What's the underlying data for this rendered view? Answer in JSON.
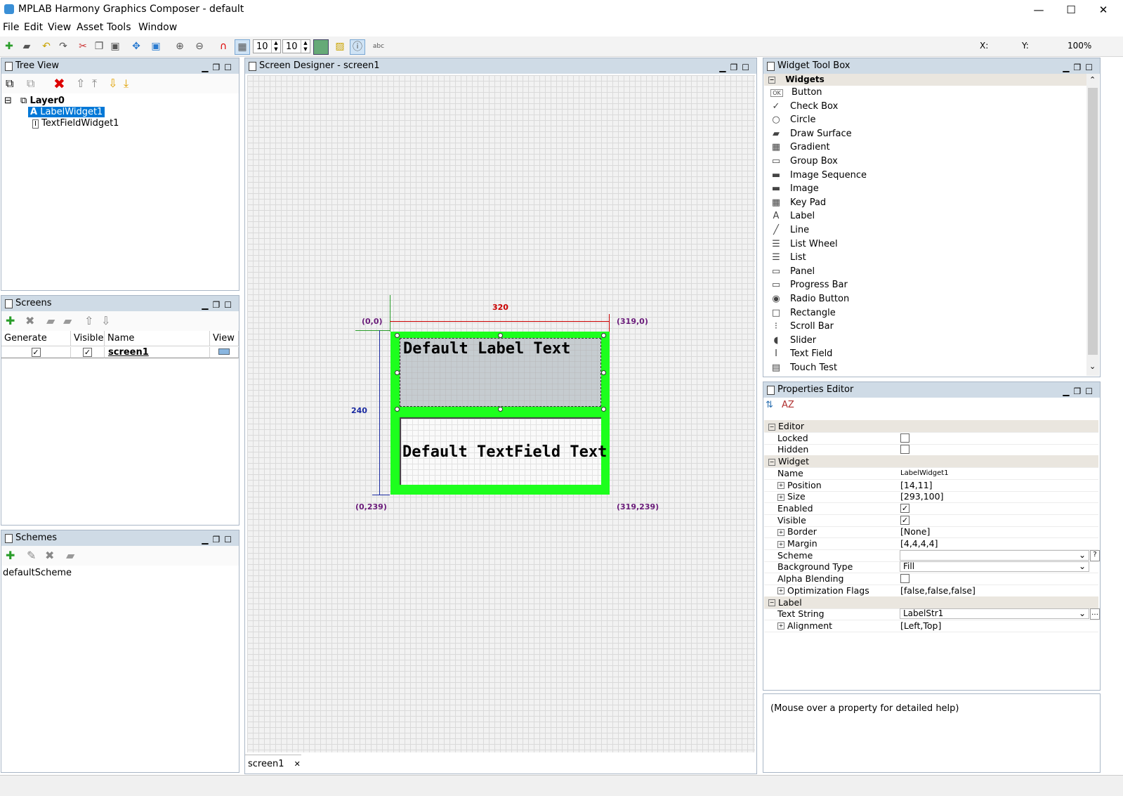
{
  "window": {
    "title": "MPLAB Harmony Graphics Composer - default",
    "min": "—",
    "max": "☐",
    "close": "✕"
  },
  "menu": [
    "File",
    "Edit",
    "View",
    "Asset",
    "Tools",
    "Window"
  ],
  "toolbar": {
    "grid_x": "10",
    "grid_y": "10",
    "abc": "abc",
    "x_label": "X:",
    "y_label": "Y:",
    "zoom": "100%"
  },
  "tree_view": {
    "title": "Tree View",
    "layer": "Layer0",
    "widgets": [
      "LabelWidget1",
      "TextFieldWidget1"
    ]
  },
  "screens": {
    "title": "Screens",
    "columns": [
      "Generate",
      "Visible",
      "Name",
      "View"
    ],
    "rows": [
      {
        "generate": "✓",
        "visible": "✓",
        "name": "screen1"
      }
    ]
  },
  "schemes": {
    "title": "Schemes",
    "items": [
      "defaultScheme"
    ]
  },
  "designer": {
    "title": "Screen Designer - screen1",
    "width_label": "320",
    "height_label": "240",
    "coords": {
      "tl": "(0,0)",
      "tr": "(319,0)",
      "bl": "(0,239)",
      "br": "(319,239)"
    },
    "label_text": "Default Label Text",
    "textfield_text": "Default TextField Text",
    "tab": "screen1",
    "tab_close": "✕",
    "screen_color": "#1dff1d"
  },
  "toolbox": {
    "title": "Widget Tool Box",
    "group": "Widgets",
    "items": [
      {
        "label": "Button",
        "icon": "OK"
      },
      {
        "label": "Check Box",
        "icon": "✓"
      },
      {
        "label": "Circle",
        "icon": "○"
      },
      {
        "label": "Draw Surface",
        "icon": "▰"
      },
      {
        "label": "Gradient",
        "icon": "▦"
      },
      {
        "label": "Group Box",
        "icon": "▭"
      },
      {
        "label": "Image Sequence",
        "icon": "▬"
      },
      {
        "label": "Image",
        "icon": "▬"
      },
      {
        "label": "Key Pad",
        "icon": "▦"
      },
      {
        "label": "Label",
        "icon": "A"
      },
      {
        "label": "Line",
        "icon": "╱"
      },
      {
        "label": "List Wheel",
        "icon": "☰"
      },
      {
        "label": "List",
        "icon": "☰"
      },
      {
        "label": "Panel",
        "icon": "▭"
      },
      {
        "label": "Progress Bar",
        "icon": "▭"
      },
      {
        "label": "Radio Button",
        "icon": "◉"
      },
      {
        "label": "Rectangle",
        "icon": "□"
      },
      {
        "label": "Scroll Bar",
        "icon": "⁝"
      },
      {
        "label": "Slider",
        "icon": "◖"
      },
      {
        "label": "Text Field",
        "icon": "I"
      },
      {
        "label": "Touch Test",
        "icon": "▤"
      }
    ]
  },
  "properties": {
    "title": "Properties Editor",
    "help": "(Mouse over a property for detailed help)",
    "rows": [
      {
        "type": "group",
        "key": "Editor"
      },
      {
        "type": "check",
        "key": "Locked",
        "checked": false
      },
      {
        "type": "check",
        "key": "Hidden",
        "checked": false
      },
      {
        "type": "group",
        "key": "Widget"
      },
      {
        "type": "text",
        "key": "Name",
        "value": "LabelWidget1"
      },
      {
        "type": "text",
        "key": "Position",
        "value": "[14,11]",
        "expand": true
      },
      {
        "type": "text",
        "key": "Size",
        "value": "[293,100]",
        "expand": true
      },
      {
        "type": "check",
        "key": "Enabled",
        "checked": true
      },
      {
        "type": "check",
        "key": "Visible",
        "checked": true
      },
      {
        "type": "text",
        "key": "Border",
        "value": "[None]",
        "expand": true
      },
      {
        "type": "text",
        "key": "Margin",
        "value": "[4,4,4,4]",
        "expand": true
      },
      {
        "type": "combo",
        "key": "Scheme",
        "value": ""
      },
      {
        "type": "combo",
        "key": "Background Type",
        "value": "Fill"
      },
      {
        "type": "check",
        "key": "Alpha Blending",
        "checked": false
      },
      {
        "type": "text",
        "key": "Optimization Flags",
        "value": "[false,false,false]",
        "expand": true
      },
      {
        "type": "group",
        "key": "Label"
      },
      {
        "type": "combo",
        "key": "Text String",
        "value": "LabelStr1"
      },
      {
        "type": "text",
        "key": "Alignment",
        "value": "[Left,Top]",
        "expand": true
      }
    ]
  }
}
